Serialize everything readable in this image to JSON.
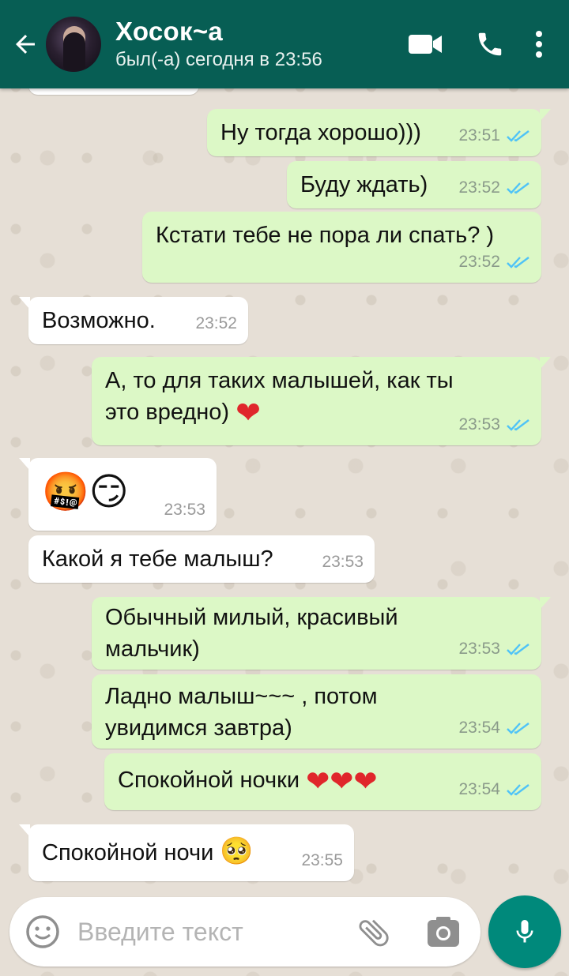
{
  "header": {
    "contact_name": "Хосок~а",
    "status": "был(-а) сегодня в 23:56"
  },
  "messages": [
    {
      "direction": "outgoing",
      "text": "Ну тогда хорошо)))",
      "time": "23:51",
      "read": true
    },
    {
      "direction": "outgoing",
      "text": "Буду ждать)",
      "time": "23:52",
      "read": true
    },
    {
      "direction": "outgoing",
      "text": "Кстати тебе не пора ли спать? )",
      "time": "23:52",
      "read": true
    },
    {
      "direction": "incoming",
      "text": "Возможно.",
      "time": "23:52"
    },
    {
      "direction": "outgoing",
      "text_line1": "А, то для таких малышей, как ты",
      "text_line2": "это вредно)",
      "emoji": "❤",
      "time": "23:53",
      "read": true
    },
    {
      "direction": "incoming",
      "emoji": "🤬😏",
      "time": "23:53"
    },
    {
      "direction": "incoming",
      "text": "Какой я тебе малыш?",
      "time": "23:53"
    },
    {
      "direction": "outgoing",
      "text_line1": "Обычный милый, красивый",
      "text_line2": "мальчик)",
      "time": "23:53",
      "read": true
    },
    {
      "direction": "outgoing",
      "text_line1": "Ладно малыш~~~ , потом",
      "text_line2": "увидимся завтра)",
      "time": "23:54",
      "read": true
    },
    {
      "direction": "outgoing",
      "text": "Спокойной ночки",
      "emoji": "❤❤❤",
      "time": "23:54",
      "read": true
    },
    {
      "direction": "incoming",
      "text": "Спокойной ночи",
      "emoji": "🥺",
      "time": "23:55"
    }
  ],
  "input": {
    "placeholder": "Введите текст"
  },
  "colors": {
    "header": "#075e54",
    "outgoing_bubble": "#dcf8c6",
    "incoming_bubble": "#ffffff",
    "read_ticks": "#4fc3f7",
    "mic_button": "#00897b"
  },
  "icons": [
    "back-arrow-icon",
    "video-call-icon",
    "phone-icon",
    "more-vert-icon",
    "emoji-icon",
    "attach-icon",
    "camera-icon",
    "mic-icon"
  ]
}
